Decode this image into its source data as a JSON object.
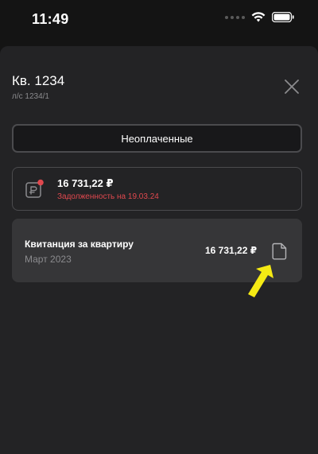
{
  "status_bar": {
    "time": "11:49",
    "icons": [
      "signal-dots-icon",
      "wifi-icon",
      "battery-icon"
    ]
  },
  "apartment": {
    "title": "Кв. 1234",
    "account": "л/с 1234/1"
  },
  "tab": {
    "label": "Неоплаченные"
  },
  "debt": {
    "amount": "16 731,22 ₽",
    "label": "Задолженность на 19.03.24",
    "icon": "ruble-receipt-icon"
  },
  "receipt": {
    "title": "Квитанция за квартиру",
    "period": "Март 2023",
    "amount": "16 731,22 ₽",
    "icon": "document-icon"
  },
  "colors": {
    "background": "#141414",
    "sheet": "#232325",
    "card_highlight": "#363638",
    "debt_warning": "#e0484e",
    "notification_dot": "#e0484e",
    "pointer": "#f5ea14"
  }
}
